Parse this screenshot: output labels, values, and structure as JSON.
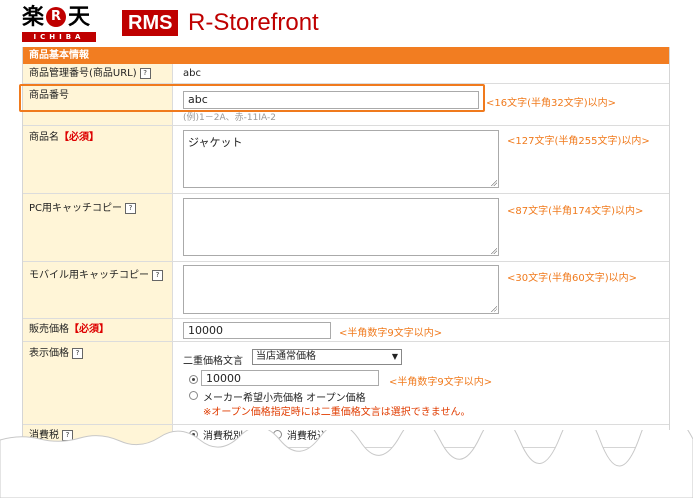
{
  "header": {
    "logo_kanji_left": "楽",
    "logo_r": "R",
    "logo_kanji_right": "天",
    "logo_sub": "ICHIBA",
    "rms_badge": "RMS",
    "rms_title": "R-Storefront"
  },
  "section": {
    "title": "商品基本情報"
  },
  "fields": {
    "manage_number": {
      "label": "商品管理番号(商品URL)",
      "value": "abc"
    },
    "item_number": {
      "label": "商品番号",
      "value": "abc",
      "example": "(例)1－2A、赤-11IA-2",
      "limit": "<16文字(半角32文字)以内>"
    },
    "item_name": {
      "label": "商品名",
      "required": "【必須】",
      "value": "ジャケット",
      "limit": "<127文字(半角255文字)以内>"
    },
    "pc_catch": {
      "label": "PC用キャッチコピー",
      "value": "",
      "limit": "<87文字(半角174文字)以内>"
    },
    "mobile_catch": {
      "label": "モバイル用キャッチコピー",
      "value": "",
      "limit": "<30文字(半角60文字)以内>"
    },
    "sale_price": {
      "label": "販売価格",
      "required": "【必須】",
      "value": "10000",
      "limit": "<半角数字9文字以内>"
    },
    "display_price": {
      "label": "表示価格",
      "dual_price_label": "二重価格文言",
      "dual_price_selected": "当店通常価格",
      "price_value": "10000",
      "price_limit": "<半角数字9文字以内>",
      "open_price_label": "メーカー希望小売価格 オープン価格",
      "warning": "※オープン価格指定時には二重価格文言は選択できません。"
    },
    "tax": {
      "label": "消費税",
      "option_excluded": "消費税別",
      "option_included": "消費税込"
    }
  }
}
